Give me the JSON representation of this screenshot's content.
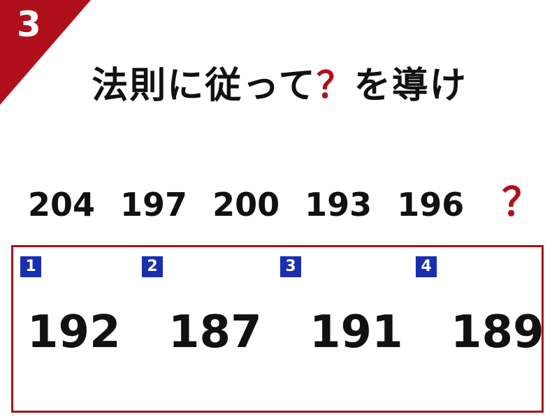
{
  "problem_number": "3",
  "title": {
    "text_before": "法則に従って",
    "mark": "？",
    "text_after": "を導け"
  },
  "sequence": {
    "numbers": [
      "204",
      "197",
      "200",
      "193",
      "196"
    ],
    "unknown": "？"
  },
  "choices": [
    {
      "label": "1",
      "value": "192"
    },
    {
      "label": "2",
      "value": "187"
    },
    {
      "label": "3",
      "value": "191"
    },
    {
      "label": "4",
      "value": "189"
    }
  ],
  "colors": {
    "accent_red": "#b0101c",
    "badge_blue": "#1a2fb0"
  }
}
